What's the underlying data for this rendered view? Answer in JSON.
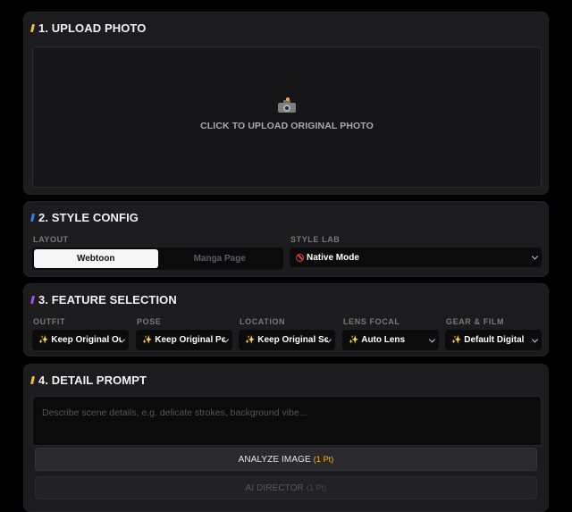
{
  "upload": {
    "title": "1. UPLOAD PHOTO",
    "accent": "#f2c21b",
    "camera_icon": "camera-flash-icon",
    "cta": "CLICK TO UPLOAD ORIGINAL PHOTO"
  },
  "style": {
    "title": "2. STYLE CONFIG",
    "accent": "#3b7cff",
    "layout_label": "LAYOUT",
    "layout_options": [
      "Webtoon",
      "Manga Page"
    ],
    "layout_selected": "Webtoon",
    "stylelab_label": "STYLE LAB",
    "stylelab_icon": "prohibited-icon",
    "stylelab_value": "Native Mode"
  },
  "feature": {
    "title": "3. FEATURE SELECTION",
    "accent": "#a24cf5",
    "fields": [
      {
        "label": "OUTFIT",
        "value": "Keep Original Outfit"
      },
      {
        "label": "POSE",
        "value": "Keep Original Pose"
      },
      {
        "label": "LOCATION",
        "value": "Keep Original Scene"
      },
      {
        "label": "LENS FOCAL",
        "value": "Auto Lens"
      },
      {
        "label": "GEAR & FILM",
        "value": "Default Digital"
      }
    ],
    "option_icon": "sparkle-icon"
  },
  "prompt": {
    "title": "4. DETAIL PROMPT",
    "accent": "#f2c21b",
    "placeholder": "Describe scene details, e.g. delicate strokes, background vibe...",
    "analyze_label": "ANALYZE IMAGE",
    "analyze_cost": "(1 Pt)",
    "director_label": "AI DIRECTOR",
    "director_cost": "(1 Pt)"
  }
}
